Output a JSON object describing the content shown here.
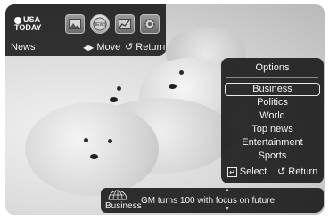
{
  "widget": {
    "logo_text_1": "USA",
    "logo_text_2": "TODAY",
    "section_label": "News",
    "move_hint": "Move",
    "return_hint": "Return",
    "icons": [
      "photos-icon",
      "news-icon",
      "chart-icon",
      "settings-icon"
    ]
  },
  "options": {
    "title": "Options",
    "items": [
      "Business",
      "Politics",
      "World",
      "Top news",
      "Entertainment",
      "Sports"
    ],
    "selected_index": 0,
    "select_hint": "Select",
    "return_hint": "Return"
  },
  "ticker": {
    "category": "Business",
    "headline": "GM turns 100 with focus on future"
  }
}
